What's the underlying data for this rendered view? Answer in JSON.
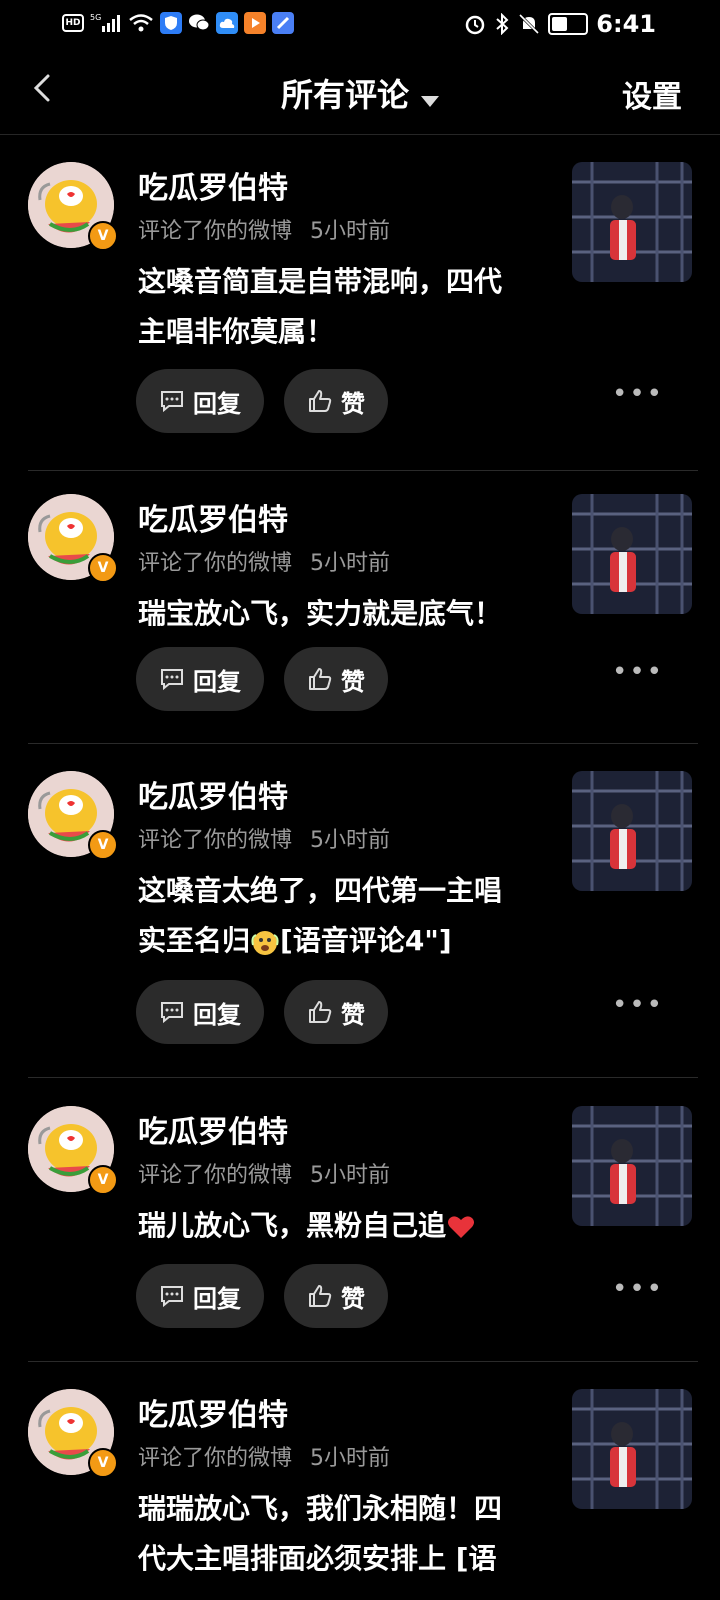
{
  "status_bar": {
    "left_icons": [
      "hd-icon",
      "5g-signal-icon",
      "wifi-icon",
      "shield-app-icon",
      "wechat-icon",
      "cloud-app-icon",
      "video-app-icon",
      "browser-app-icon"
    ],
    "right_icons": [
      "alarm-icon",
      "bluetooth-icon",
      "mute-icon",
      "battery-icon"
    ],
    "time": "6:41",
    "battery_level": 0.6
  },
  "header": {
    "title": "所有评论",
    "settings_label": "设置"
  },
  "colors": {
    "background": "#000000",
    "pill": "#2b2b2b",
    "meta_text": "#9a9a9a",
    "badge": "#f39a14"
  },
  "comments": [
    {
      "user": "吃瓜罗伯特",
      "action": "评论了你的微博",
      "time": "5小时前",
      "text": "这嗓音简直是自带混响，四代主唱非你莫属！",
      "reply_label": "回复",
      "like_label": "赞"
    },
    {
      "user": "吃瓜罗伯特",
      "action": "评论了你的微博",
      "time": "5小时前",
      "text": "瑞宝放心飞，实力就是底气！",
      "reply_label": "回复",
      "like_label": "赞"
    },
    {
      "user": "吃瓜罗伯特",
      "action": "评论了你的微博",
      "time": "5小时前",
      "text_before_emoji": "这嗓音太绝了，四代第一主唱实至名归",
      "text_after_emoji": "[语音评论4\"]",
      "reply_label": "回复",
      "like_label": "赞"
    },
    {
      "user": "吃瓜罗伯特",
      "action": "评论了你的微博",
      "time": "5小时前",
      "text": "瑞儿放心飞，黑粉自己追",
      "reply_label": "回复",
      "like_label": "赞"
    },
    {
      "user": "吃瓜罗伯特",
      "action": "评论了你的微博",
      "time": "5小时前",
      "text": "瑞瑞放心飞，我们永相随！四代大主唱排面必须安排上 [语"
    }
  ]
}
